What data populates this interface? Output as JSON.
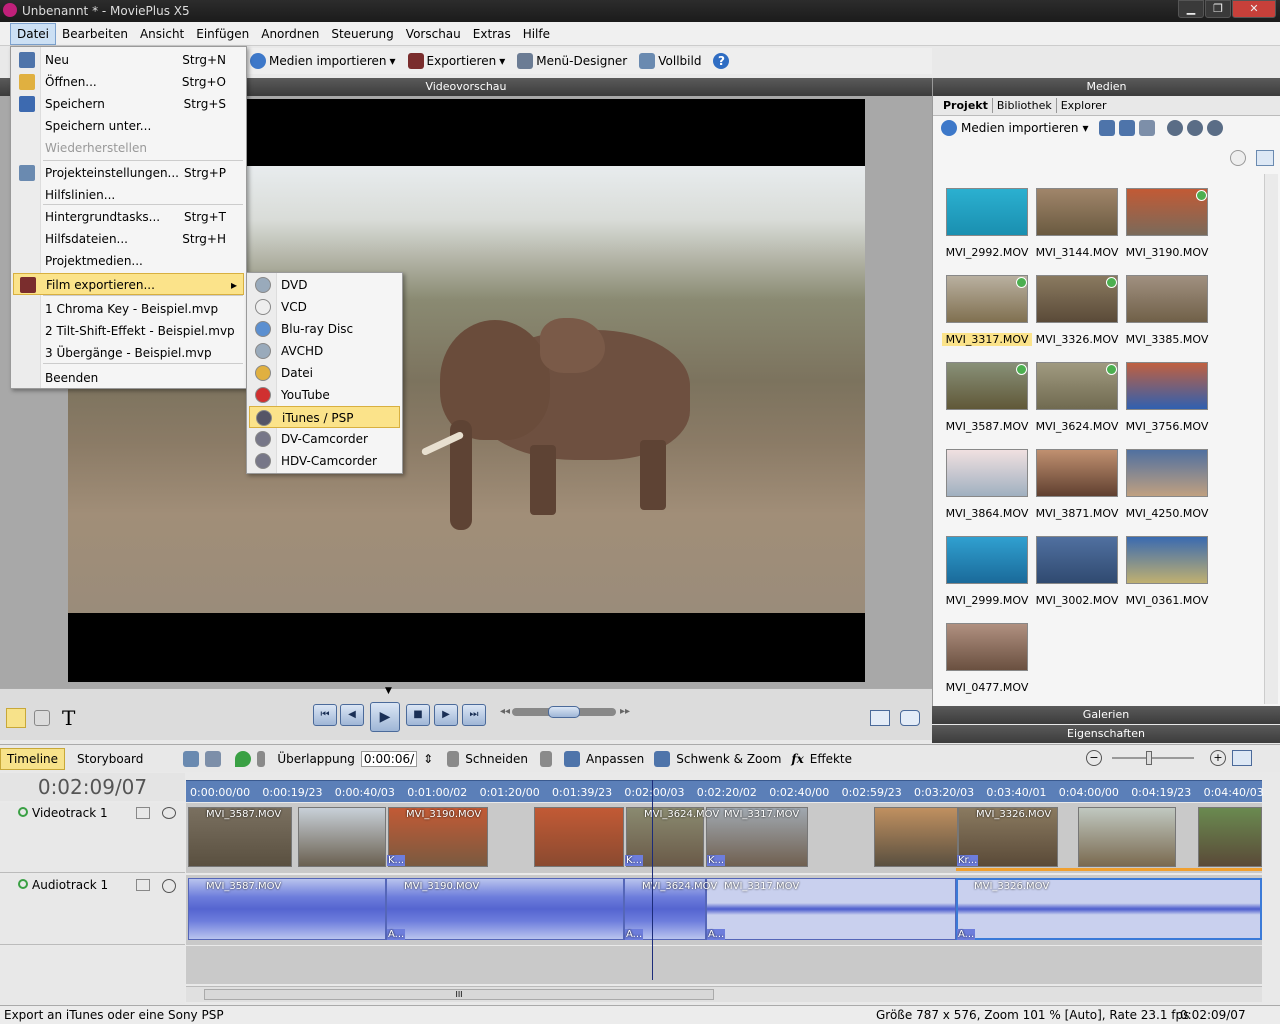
{
  "window": {
    "title": "Unbenannt * - MoviePlus X5",
    "minimize": "▁",
    "maximize": "❐",
    "close": "✕"
  },
  "menubar": {
    "items": [
      "Datei",
      "Bearbeiten",
      "Ansicht",
      "Einfügen",
      "Anordnen",
      "Steuerung",
      "Vorschau",
      "Extras",
      "Hilfe"
    ]
  },
  "toolbar": {
    "import": "Medien importieren",
    "export": "Exportieren",
    "menu_designer": "Menü-Designer",
    "fullscreen": "Vollbild",
    "help": "?"
  },
  "preview": {
    "title": "Videovorschau"
  },
  "file_menu": {
    "items": [
      {
        "label": "Neu",
        "shortcut": "Strg+N"
      },
      {
        "label": "Öffnen...",
        "shortcut": "Strg+O"
      },
      {
        "label": "Speichern",
        "shortcut": "Strg+S"
      },
      {
        "label": "Speichern unter...",
        "shortcut": ""
      },
      {
        "label": "Wiederherstellen",
        "shortcut": ""
      },
      {
        "label": "Projekteinstellungen...",
        "shortcut": "Strg+P"
      },
      {
        "label": "Hilfslinien...",
        "shortcut": ""
      },
      {
        "label": "Hintergrundtasks...",
        "shortcut": "Strg+T"
      },
      {
        "label": "Hilfsdateien...",
        "shortcut": "Strg+H"
      },
      {
        "label": "Projektmedien...",
        "shortcut": ""
      },
      {
        "label": "Film exportieren...",
        "shortcut": ""
      },
      {
        "label": "1 Chroma Key - Beispiel.mvp",
        "shortcut": ""
      },
      {
        "label": "2 Tilt-Shift-Effekt - Beispiel.mvp",
        "shortcut": ""
      },
      {
        "label": "3 Übergänge - Beispiel.mvp",
        "shortcut": ""
      },
      {
        "label": "Beenden",
        "shortcut": ""
      }
    ]
  },
  "export_submenu": {
    "items": [
      "DVD",
      "VCD",
      "Blu-ray Disc",
      "AVCHD",
      "Datei",
      "YouTube",
      "iTunes / PSP",
      "DV-Camcorder",
      "HDV-Camcorder"
    ]
  },
  "media_panel": {
    "title": "Medien",
    "tabs": [
      "Projekt",
      "Bibliothek",
      "Explorer"
    ],
    "import": "Medien importieren",
    "files": [
      "MVI_2992.MOV",
      "MVI_3144.MOV",
      "MVI_3190.MOV",
      "MVI_3317.MOV",
      "MVI_3326.MOV",
      "MVI_3385.MOV",
      "MVI_3587.MOV",
      "MVI_3624.MOV",
      "MVI_3756.MOV",
      "MVI_3864.MOV",
      "MVI_3871.MOV",
      "MVI_4250.MOV",
      "MVI_2999.MOV",
      "MVI_3002.MOV",
      "MVI_0361.MOV",
      "MVI_0477.MOV"
    ],
    "galleries": "Galerien",
    "properties": "Eigenschaften"
  },
  "timeline": {
    "tabs": [
      "Timeline",
      "Storyboard"
    ],
    "overlap_label": "Überlappung",
    "overlap_value": "0:00:06/",
    "cut": "Schneiden",
    "fit": "Anpassen",
    "pan_zoom": "Schwenk & Zoom",
    "effects": "Effekte",
    "effects_icon": "fx",
    "timecode": "0:02:09/07",
    "ruler": [
      "0:00:00/00",
      "0:00:19/23",
      "0:00:40/03",
      "0:01:00/02",
      "0:01:20/00",
      "0:01:39/23",
      "0:02:00/03",
      "0:02:20/02",
      "0:02:40/00",
      "0:02:59/23",
      "0:03:20/03",
      "0:03:40/01",
      "0:04:00/00",
      "0:04:19/23",
      "0:04:40/03"
    ],
    "video_track": "Videotrack 1",
    "audio_track": "Audiotrack 1",
    "video_clips": [
      "MVI_3587.MOV",
      "MVI_3190.MOV",
      "MVI_3624.MOV",
      "MVI_3317.MOV",
      "MVI_3326.MOV"
    ],
    "transition_labels": [
      "K...",
      "K...",
      "K...",
      "Kr..."
    ],
    "audio_transition_labels": [
      "A...",
      "A...",
      "A...",
      "A..."
    ],
    "scroll_grip": "III"
  },
  "status": {
    "left": "Export an iTunes oder eine Sony PSP",
    "info": "Größe 787 x 576, Zoom 101 % [Auto], Rate 23.1 fps",
    "time": "0:02:09/07"
  }
}
